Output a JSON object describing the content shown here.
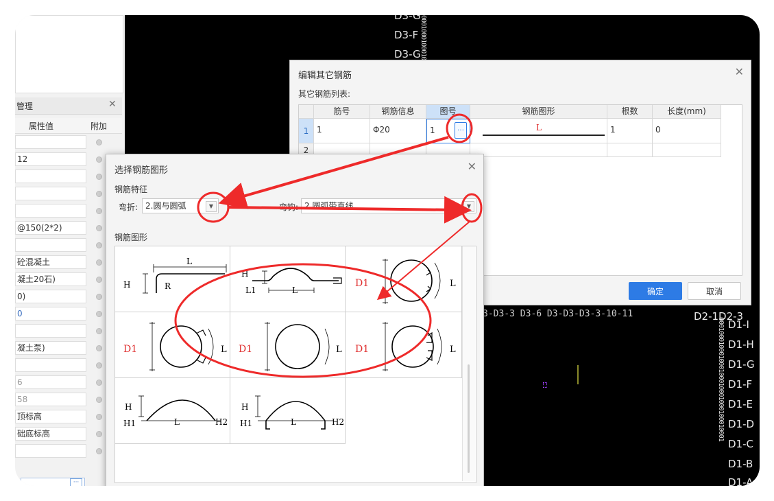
{
  "colors": {
    "accent": "#2d7be5",
    "annotation_red": "#ee2a2a",
    "cad_background": "#000000",
    "shape_label_red": "#e03030"
  },
  "left_panel": {
    "title": "属性管理",
    "title_visible_fragment": "管理",
    "column_value": "属性值",
    "column_extra": "附加",
    "rows": [
      "",
      "12",
      "",
      "",
      "",
      "@150(2*2)",
      "",
      "砼混凝土",
      "凝土20石)",
      "0)",
      "0",
      "",
      "凝土泵)",
      "",
      "6",
      "58",
      "顶标高",
      "础底标高",
      ""
    ]
  },
  "cad": {
    "top_labels": [
      "D3-G",
      "D3-F",
      "D3-G"
    ],
    "right_labels": [
      "D1-I",
      "D1-H",
      "D1-G",
      "D1-F",
      "D1-E",
      "D1-D",
      "D1-C",
      "D1-B",
      "D1-A"
    ],
    "mid_strip": "3-D3-3 D3-6 D3-D3-D3-3-10-11",
    "mid_right": "D2-1D2-3",
    "vertical_text": "000100010001000100010001000100010001"
  },
  "edit_dialog": {
    "title": "编辑其它钢筋",
    "list_label": "其它钢筋列表:",
    "columns": [
      "筋号",
      "钢筋信息",
      "图号",
      "钢筋图形",
      "根数",
      "长度(mm)"
    ],
    "rows": [
      {
        "index": "1",
        "bar_no": "1",
        "bar_info": "Φ20",
        "shape_no": "1",
        "shape_label": "L",
        "count": "1",
        "length": "0"
      },
      {
        "index": "2",
        "bar_no": "",
        "bar_info": "",
        "shape_no": "",
        "shape_label": "",
        "count": "",
        "length": ""
      }
    ],
    "ellipsis": "…",
    "ok": "确定",
    "cancel": "取消"
  },
  "select_dialog": {
    "title": "选择钢筋图形",
    "feature_section": "钢筋特征",
    "bend_label": "弯折:",
    "bend_value": "2.圆与圆弧",
    "bend2_label": "弯钩:",
    "bend2_value": "2.圆弧带直线",
    "shape_section": "钢筋图形",
    "shapes": [
      {
        "id": "shape-1",
        "labels": [
          "H",
          "R",
          "L"
        ]
      },
      {
        "id": "shape-2",
        "labels": [
          "H",
          "L1",
          "L"
        ]
      },
      {
        "id": "shape-3",
        "labels": [
          "D1",
          "L"
        ]
      },
      {
        "id": "shape-4",
        "labels": [
          "D1",
          "L"
        ]
      },
      {
        "id": "shape-5",
        "labels": [
          "D1",
          "L"
        ]
      },
      {
        "id": "shape-6",
        "labels": [
          "D1",
          "L"
        ]
      },
      {
        "id": "shape-7",
        "labels": [
          "H",
          "H1",
          "L",
          "H2"
        ]
      },
      {
        "id": "shape-8",
        "labels": [
          "H",
          "H1",
          "L",
          "H2"
        ]
      }
    ]
  }
}
